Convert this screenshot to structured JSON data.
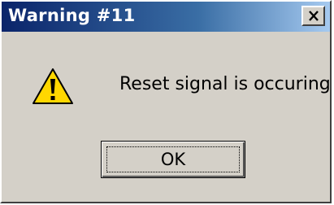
{
  "window": {
    "title": "Warning #11"
  },
  "titlebar": {
    "close_icon": "close-icon"
  },
  "content": {
    "icon": "warning-icon",
    "message": "Reset signal is occuring"
  },
  "buttons": {
    "ok_label": "OK"
  },
  "colors": {
    "titlebar_start": "#0a246a",
    "titlebar_end": "#a6caf0",
    "dialog_bg": "#d4d0c8",
    "warning_yellow": "#ffd700"
  }
}
